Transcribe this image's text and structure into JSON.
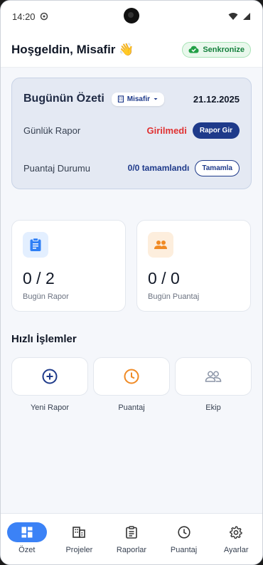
{
  "status_bar": {
    "time": "14:20"
  },
  "header": {
    "greeting": "Hoşgeldin, Misafir 👋",
    "sync_label": "Senkronize"
  },
  "summary": {
    "title": "Bugünün Özeti",
    "filter_label": "Misafir",
    "date": "21.12.2025",
    "daily_report": {
      "label": "Günlük Rapor",
      "status": "Girilmedi",
      "button": "Rapor Gir"
    },
    "timesheet": {
      "label": "Puantaj Durumu",
      "status": "0/0 tamamlandı",
      "button": "Tamamla"
    }
  },
  "stats": [
    {
      "value": "0 / 2",
      "caption": "Bugün Rapor",
      "icon": "clipboard-icon",
      "color": "#2f7ff5"
    },
    {
      "value": "0 / 0",
      "caption": "Bugün Puantaj",
      "icon": "people-icon",
      "color": "#f08a24"
    }
  ],
  "quick_actions": {
    "title": "Hızlı İşlemler",
    "items": [
      {
        "label": "Yeni Rapor",
        "icon": "plus-circle-icon"
      },
      {
        "label": "Puantaj",
        "icon": "clock-icon"
      },
      {
        "label": "Ekip",
        "icon": "team-icon"
      }
    ]
  },
  "nav": {
    "items": [
      {
        "label": "Özet",
        "icon": "dashboard-icon",
        "active": true
      },
      {
        "label": "Projeler",
        "icon": "building-icon"
      },
      {
        "label": "Raporlar",
        "icon": "clipboard-icon"
      },
      {
        "label": "Puantaj",
        "icon": "clock-icon"
      },
      {
        "label": "Ayarlar",
        "icon": "gear-icon"
      }
    ]
  },
  "colors": {
    "primary": "#1e3a8a",
    "accent_blue": "#3b82f6",
    "danger": "#e03131",
    "success": "#15803d",
    "orange": "#f08a24"
  }
}
